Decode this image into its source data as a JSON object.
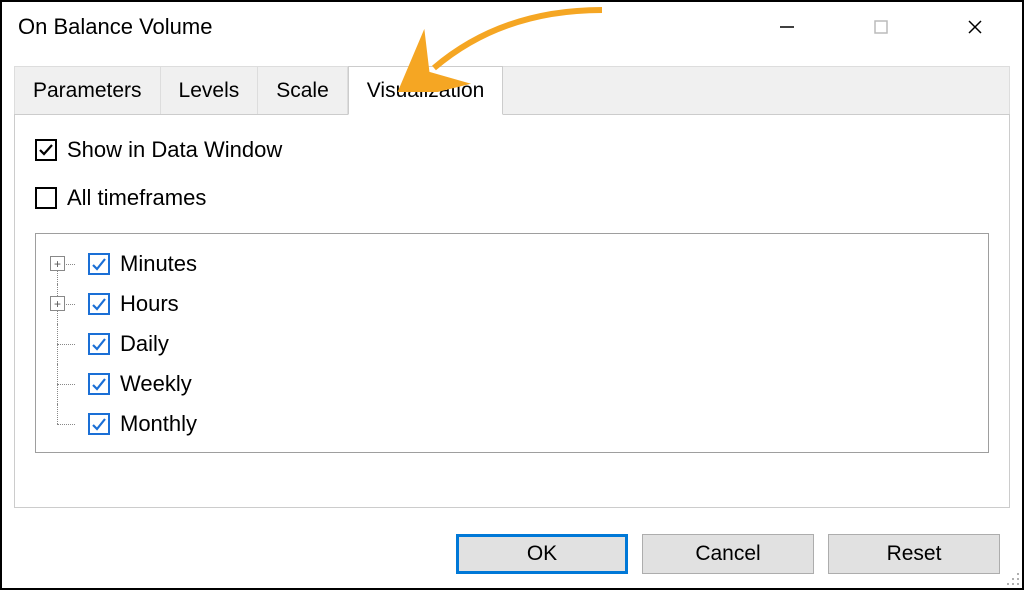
{
  "window": {
    "title": "On Balance Volume"
  },
  "tabs": {
    "items": [
      {
        "label": "Parameters",
        "active": false
      },
      {
        "label": "Levels",
        "active": false
      },
      {
        "label": "Scale",
        "active": false
      },
      {
        "label": "Visualization",
        "active": true
      }
    ]
  },
  "panel": {
    "show_in_data_window": {
      "label": "Show in Data Window",
      "checked": true
    },
    "all_timeframes": {
      "label": "All timeframes",
      "checked": false
    },
    "tree": [
      {
        "label": "Minutes",
        "checked": true,
        "expandable": true
      },
      {
        "label": "Hours",
        "checked": true,
        "expandable": true
      },
      {
        "label": "Daily",
        "checked": true,
        "expandable": false
      },
      {
        "label": "Weekly",
        "checked": true,
        "expandable": false
      },
      {
        "label": "Monthly",
        "checked": true,
        "expandable": false
      }
    ]
  },
  "buttons": {
    "ok": "OK",
    "cancel": "Cancel",
    "reset": "Reset"
  }
}
